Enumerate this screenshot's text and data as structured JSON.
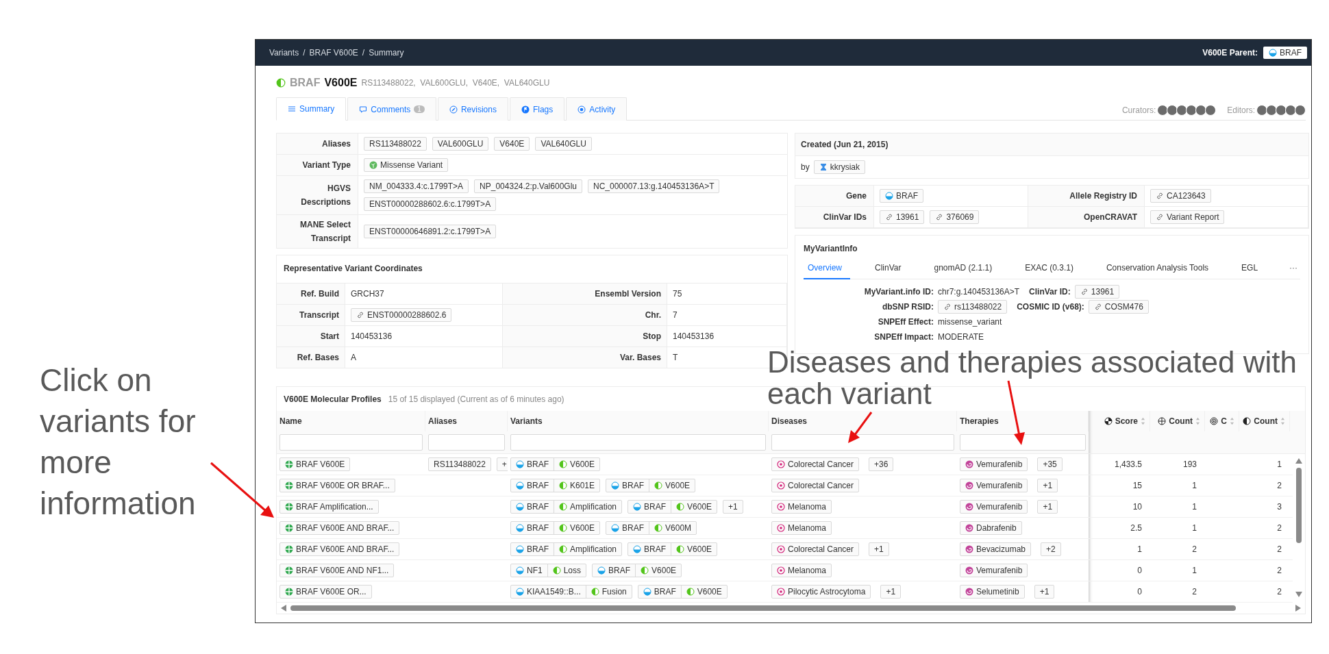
{
  "annotations": {
    "left": "Click on variants for more information",
    "top": [
      "Diseases and therapies associated with",
      "each variant"
    ]
  },
  "breadcrumb": {
    "items": [
      "Variants",
      "BRAF V600E",
      "Summary"
    ],
    "separator": "/"
  },
  "parent": {
    "label": "V600E Parent:",
    "gene": "BRAF"
  },
  "heading": {
    "gene": "BRAF",
    "variant": "V600E",
    "aliases": "RS113488022,  VAL600GLU,  V640E,  VAL640GLU"
  },
  "tabs": [
    {
      "label": "Summary",
      "selected": true
    },
    {
      "label": "Comments",
      "badge": "1",
      "selected": false
    },
    {
      "label": "Revisions",
      "selected": false
    },
    {
      "label": "Flags",
      "selected": false
    },
    {
      "label": "Activity",
      "selected": false
    }
  ],
  "curators": {
    "label": "Curators:"
  },
  "editors": {
    "label": "Editors:"
  },
  "summary": [
    {
      "label": "Aliases",
      "kind": "plain",
      "tags": [
        "RS113488022",
        "VAL600GLU",
        "V640E",
        "VAL640GLU"
      ]
    },
    {
      "label": "Variant Type",
      "kind": "type",
      "tags": [
        "Missense Variant"
      ]
    },
    {
      "label": "HGVS Descriptions",
      "kind": "plain",
      "tags": [
        "NM_004333.4:c.1799T>A",
        "NP_004324.2:p.Val600Glu",
        "NC_000007.13:g.140453136A>T",
        "ENST00000288602.6:c.1799T>A"
      ]
    },
    {
      "label": "MANE Select Transcript",
      "kind": "plain",
      "tags": [
        "ENST00000646891.2:c.1799T>A"
      ]
    }
  ],
  "coordinates": {
    "title": "Representative Variant Coordinates",
    "rows": [
      [
        {
          "label": "Ref. Build",
          "kind": "text",
          "value": "GRCH37"
        },
        {
          "label": "Ensembl Version",
          "kind": "text",
          "value": "75"
        }
      ],
      [
        {
          "label": "Transcript",
          "kind": "link",
          "value": "ENST00000288602.6"
        },
        {
          "label": "Chr.",
          "kind": "text",
          "value": "7"
        }
      ],
      [
        {
          "label": "Start",
          "kind": "text",
          "value": "140453136"
        },
        {
          "label": "Stop",
          "kind": "text",
          "value": "140453136"
        }
      ],
      [
        {
          "label": "Ref. Bases",
          "kind": "text",
          "value": "A"
        },
        {
          "label": "Var. Bases",
          "kind": "text",
          "value": "T"
        }
      ]
    ]
  },
  "created": {
    "title": "Created (Jun 21, 2015)",
    "by": "by",
    "user": "kkrysiak"
  },
  "ids": [
    {
      "label": "Gene",
      "kind": "gene",
      "values": [
        "BRAF"
      ]
    },
    {
      "label": "Allele Registry ID",
      "kind": "link",
      "values": [
        "CA123643"
      ]
    },
    {
      "label": "ClinVar IDs",
      "kind": "link",
      "values": [
        "13961",
        "376069"
      ]
    },
    {
      "label": "OpenCRAVAT",
      "kind": "link",
      "values": [
        "Variant Report"
      ]
    }
  ],
  "myvariantinfo": {
    "title": "MyVariantInfo",
    "more": "···",
    "tabs": [
      {
        "label": "Overview",
        "selected": true
      },
      {
        "label": "ClinVar",
        "selected": false
      },
      {
        "label": "gnomAD (2.1.1)",
        "selected": false
      },
      {
        "label": "EXAC (0.3.1)",
        "selected": false
      },
      {
        "label": "Conservation Analysis Tools",
        "selected": false
      },
      {
        "label": "EGL",
        "selected": false
      }
    ],
    "fields": [
      [
        {
          "label": "MyVariant.info ID:",
          "kind": "text",
          "value": "chr7:g.140453136A>T"
        },
        {
          "label": "ClinVar ID:",
          "kind": "link",
          "value": "13961"
        }
      ],
      [
        {
          "label": "dbSNP RSID:",
          "kind": "link",
          "value": "rs113488022"
        },
        {
          "label": "COSMIC ID (v68):",
          "kind": "link",
          "value": "COSM476"
        }
      ],
      [
        {
          "label": "SNPEff Effect:",
          "kind": "text",
          "value": "missense_variant"
        }
      ],
      [
        {
          "label": "SNPEff Impact:",
          "kind": "text",
          "value": "MODERATE"
        }
      ]
    ]
  },
  "profiles": {
    "title": "V600E Molecular Profiles",
    "subtitle": "15 of 15 displayed (Current as of 6 minutes ago)",
    "columns": [
      {
        "label": "Name",
        "kind": "text"
      },
      {
        "label": "Aliases",
        "kind": "text"
      },
      {
        "label": "Variants",
        "kind": "text"
      },
      {
        "label": "Diseases",
        "kind": "text"
      },
      {
        "label": "Therapies",
        "kind": "text"
      },
      {
        "label": "Score",
        "kind": "stat"
      },
      {
        "label": "Count",
        "kind": "stat"
      },
      {
        "label": "C",
        "kind": "stat"
      },
      {
        "label": "Count",
        "kind": "stat"
      }
    ],
    "rows": [
      {
        "name": "BRAF V600E",
        "aliases": [
          "RS113488022"
        ],
        "aliases_more": "+",
        "variants": [
          {
            "gene": "BRAF",
            "variant": "V600E"
          }
        ],
        "disease": "Colorectal Cancer",
        "diseases_more": "+36",
        "therapy": "Vemurafenib",
        "therapies_more": "+35",
        "stats": [
          "1,433.5",
          "193",
          "1"
        ]
      },
      {
        "name": "BRAF V600E OR BRAF...",
        "aliases": [],
        "variants": [
          {
            "gene": "BRAF",
            "variant": "K601E"
          },
          {
            "gene": "BRAF",
            "variant": "V600E"
          }
        ],
        "disease": "Colorectal Cancer",
        "therapy": "Vemurafenib",
        "therapies_more": "+1",
        "stats": [
          "15",
          "1",
          "2"
        ]
      },
      {
        "name": "BRAF Amplification...",
        "aliases": [],
        "variants": [
          {
            "gene": "BRAF",
            "variant": "Amplification"
          },
          {
            "gene": "BRAF",
            "variant": "V600E"
          }
        ],
        "variants_more": "+1",
        "disease": "Melanoma",
        "therapy": "Vemurafenib",
        "therapies_more": "+1",
        "stats": [
          "10",
          "1",
          "3"
        ]
      },
      {
        "name": "BRAF V600E AND BRAF...",
        "aliases": [],
        "variants": [
          {
            "gene": "BRAF",
            "variant": "V600E"
          },
          {
            "gene": "BRAF",
            "variant": "V600M"
          }
        ],
        "disease": "Melanoma",
        "therapy": "Dabrafenib",
        "stats": [
          "2.5",
          "1",
          "2"
        ]
      },
      {
        "name": "BRAF V600E AND BRAF...",
        "aliases": [],
        "variants": [
          {
            "gene": "BRAF",
            "variant": "Amplification"
          },
          {
            "gene": "BRAF",
            "variant": "V600E"
          }
        ],
        "disease": "Colorectal Cancer",
        "diseases_more": "+1",
        "therapy": "Bevacizumab",
        "therapies_more": "+2",
        "stats": [
          "1",
          "2",
          "2"
        ]
      },
      {
        "name": "BRAF V600E AND NF1...",
        "aliases": [],
        "variants": [
          {
            "gene": "NF1",
            "variant": "Loss"
          },
          {
            "gene": "BRAF",
            "variant": "V600E"
          }
        ],
        "disease": "Melanoma",
        "therapy": "Vemurafenib",
        "stats": [
          "0",
          "1",
          "2"
        ]
      },
      {
        "name": "BRAF V600E OR...",
        "aliases": [],
        "variants": [
          {
            "gene": "KIAA1549::B...",
            "variant": "Fusion"
          },
          {
            "gene": "BRAF",
            "variant": "V600E"
          }
        ],
        "disease": "Pilocytic Astrocytoma",
        "diseases_more": "+1",
        "therapy": "Selumetinib",
        "therapies_more": "+1",
        "stats": [
          "0",
          "2",
          "2"
        ]
      }
    ]
  }
}
